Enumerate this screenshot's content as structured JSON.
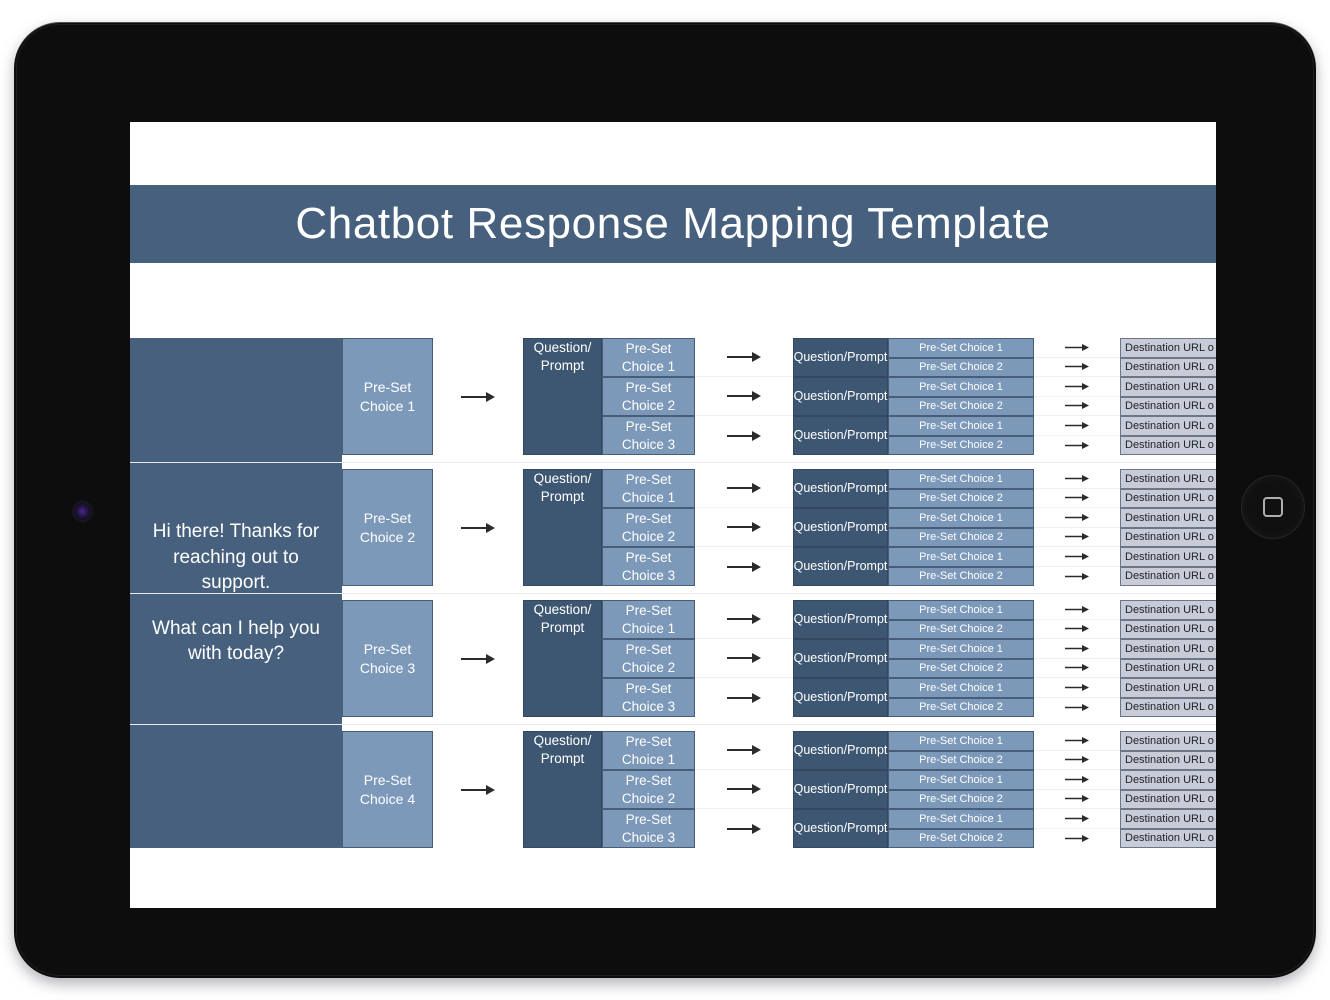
{
  "device": {
    "type": "tablet",
    "orientation": "landscape",
    "camera": "front-camera",
    "home_button": "home-button"
  },
  "slide": {
    "title": "Chatbot Response Mapping Template",
    "banner_color": "#46607d",
    "background": "#ffffff"
  },
  "colors": {
    "dark_blue": "#46607d",
    "prompt_blue": "#3d5773",
    "light_blue": "#7d99ba",
    "destination_gray": "#c7ccd8",
    "border": "#4a5d78",
    "text_light": "#ffffff"
  },
  "greeting": {
    "line1": "Hi there! Thanks for reaching out to support.",
    "line2": "What can I help you with today?"
  },
  "labels": {
    "arrow": "⟶",
    "prompt": "Question/\nPrompt",
    "prompt_line1": "Question/",
    "prompt_line2": "Prompt",
    "destination": "Destination URL o"
  },
  "flow": {
    "level1_choices": [
      "Pre-Set Choice 1",
      "Pre-Set Choice 2",
      "Pre-Set Choice 3",
      "Pre-Set Choice 4"
    ],
    "level2_choices": [
      "Pre-Set Choice 1",
      "Pre-Set Choice 2",
      "Pre-Set Choice 3"
    ],
    "level3_choices": [
      "Pre-Set Choice 1",
      "Pre-Set Choice 2",
      "Pre-Set Choice 1",
      "Pre-Set Choice 2",
      "Pre-Set Choice 1",
      "Pre-Set Choice 2"
    ],
    "destinations": [
      "Destination URL o",
      "Destination URL o",
      "Destination URL o",
      "Destination URL o",
      "Destination URL o",
      "Destination URL o"
    ],
    "prompts_level2": [
      "Question/ Prompt",
      "Question/ Prompt",
      "Question/ Prompt"
    ],
    "group_count": 4,
    "level2_per_group": 3,
    "level3_per_group": 6
  }
}
